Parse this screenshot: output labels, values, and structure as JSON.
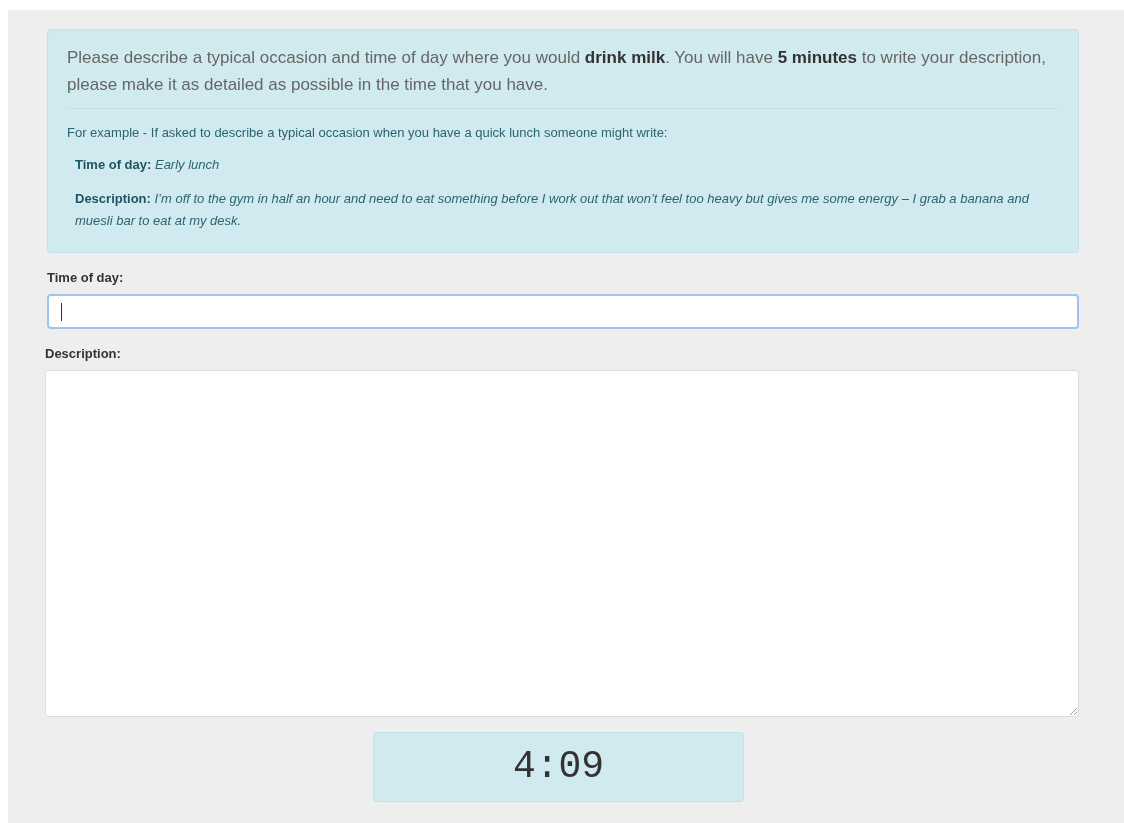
{
  "instructions": {
    "intro": "Please describe a typical occasion and time of day where you would **drink milk**. You will have **5 minutes** to write your description, please make it as detailed as possible in the time that you have.",
    "example_lead": "For example - If asked to describe a typical occasion when you have a quick lunch someone might write:",
    "example_fields": [
      {
        "label": "Time of day:",
        "value": "Early lunch"
      },
      {
        "label": "Description:",
        "value": "I’m off to the gym in half an hour and need to eat something before I work out that won’t feel too heavy but gives me some energy – I grab a banana and muesli bar to eat at my desk."
      }
    ]
  },
  "form": {
    "time_of_day": {
      "label": "Time of day:",
      "focused": true
    },
    "description": {
      "label": "Description:"
    }
  },
  "timer": "4:09"
}
